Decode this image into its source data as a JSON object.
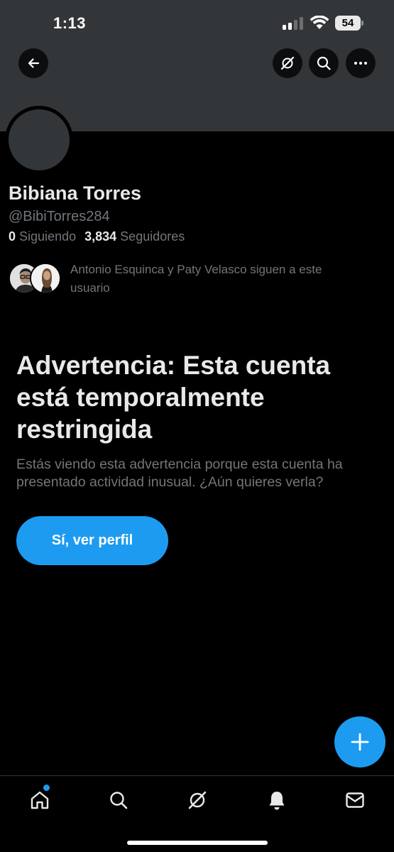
{
  "status_bar": {
    "time": "1:13",
    "battery": "54"
  },
  "profile": {
    "name": "Bibiana Torres",
    "handle": "@BibiTorres284",
    "following_count": "0",
    "following_label": "Siguiendo",
    "followers_count": "3,834",
    "followers_label": "Seguidores",
    "mutual_text": "Antonio Esquinca y Paty Velasco siguen a este usuario"
  },
  "warning": {
    "title": "Advertencia: Esta cuenta está temporalmente restringida",
    "body": "Estás viendo esta advertencia porque esta cuenta ha presentado actividad inusual. ¿Aún quieres verla?",
    "button_label": "Sí, ver perfil"
  },
  "colors": {
    "accent": "#1d9bf0",
    "background": "#000000",
    "banner": "#333639",
    "primary_text": "#e7e9ea",
    "secondary_text": "#71767b"
  },
  "icons": {
    "header": [
      "back-arrow-icon",
      "grok-icon",
      "search-icon",
      "more-icon"
    ],
    "tabbar": [
      "home-icon",
      "search-icon",
      "grok-icon",
      "notifications-bell-icon",
      "messages-envelope-icon"
    ],
    "fab": "plus-icon"
  }
}
